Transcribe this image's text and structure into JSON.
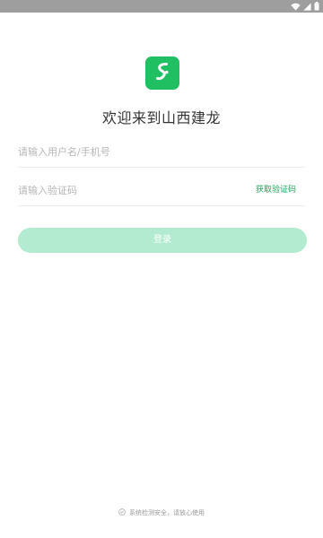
{
  "status_bar": {
    "icons": [
      "wifi-icon",
      "signal-icon",
      "battery-icon"
    ]
  },
  "app": {
    "logo_icon": "brand-s-logo-icon",
    "brand_color": "#1fbf62",
    "title": "欢迎来到山西建龙"
  },
  "form": {
    "username_placeholder": "请输入用户名/手机号",
    "username_value": "",
    "code_placeholder": "请输入验证码",
    "code_value": "",
    "get_code_label": "获取验证码",
    "login_label": "登录",
    "login_button_color": "#b3ebd0"
  },
  "footer": {
    "icon": "shield-check-icon",
    "text": "系统检测安全，请放心使用"
  }
}
